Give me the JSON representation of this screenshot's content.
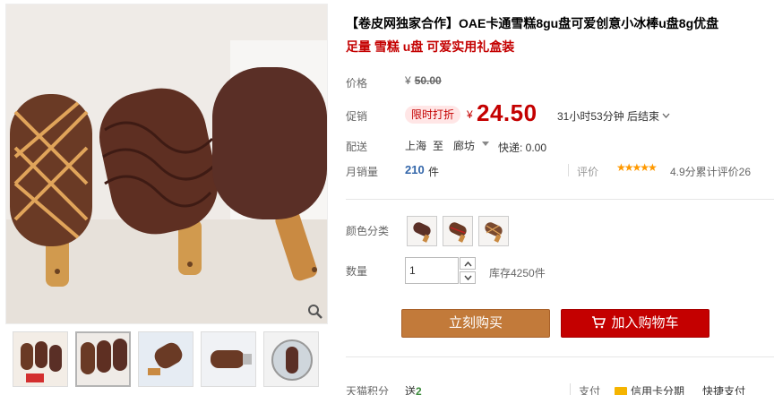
{
  "product": {
    "title": "【卷皮网独家合作】OAE卡通雪糕8gu盘可爱创意小冰棒u盘8g优盘",
    "subtitle": "足量 雪糕 u盘 可爱实用礼盒装"
  },
  "price": {
    "label": "价格",
    "currency": "¥",
    "original": "50.00"
  },
  "promo": {
    "label": "促销",
    "badge": "限时打折",
    "currency": "¥",
    "price": "24.50",
    "countdown": "31小时53分钟 后结束"
  },
  "shipping": {
    "label": "配送",
    "from": "上海",
    "to_word": "至",
    "dest": "廊坊",
    "fee": "快递: 0.00"
  },
  "sales": {
    "label": "月销量",
    "count": "210",
    "unit": "件",
    "review_label": "评价",
    "stars": "★★★★★",
    "score_text": "4.9分累计评价26"
  },
  "options": {
    "color_label": "颜色分类",
    "qty_label": "数量",
    "qty_value": "1",
    "stock": "库存4250件"
  },
  "buttons": {
    "buy": "立刻购买",
    "cart": "加入购物车"
  },
  "footer": {
    "points_label": "天猫积分",
    "points_prefix": "送",
    "points_value": "2",
    "pay_label": "支付",
    "pay_card": "信用卡分期",
    "pay_fast": "快捷支付"
  },
  "icons": {
    "zoom": "magnifier-icon",
    "cart": "cart-icon",
    "caret": "caret-down-icon",
    "stepper_up": "chevron-up-icon",
    "stepper_down": "chevron-down-icon"
  },
  "colors": {
    "accent_red": "#c40000",
    "buy_button": "#c27a3a",
    "link_blue": "#3366aa",
    "star": "#ff9900"
  }
}
